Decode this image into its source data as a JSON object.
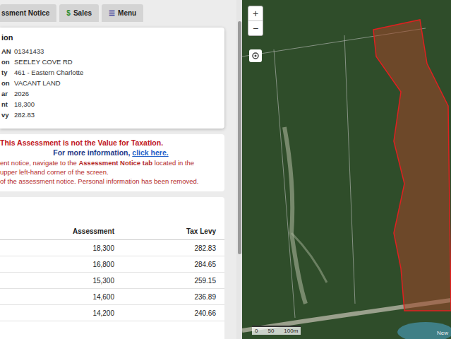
{
  "tabs": [
    {
      "label": "ssment Notice",
      "icon": "",
      "selected": false
    },
    {
      "label": "Sales",
      "icon": "$",
      "selected": false
    },
    {
      "label": "Menu",
      "icon": "☰",
      "selected": false
    }
  ],
  "info": {
    "title": "ion",
    "fields": [
      {
        "label": "AN",
        "value": "01341433"
      },
      {
        "label": "on",
        "value": "SEELEY COVE RD"
      },
      {
        "label": "ty",
        "value": "461 - Eastern Charlotte"
      },
      {
        "label": "on",
        "value": "VACANT LAND"
      },
      {
        "label": "ar",
        "value": "2026"
      },
      {
        "label": "nt",
        "value": "18,300"
      },
      {
        "label": "vy",
        "value": "282.83"
      }
    ]
  },
  "notice": {
    "warning": "This Assessment is not the Value for Taxation.",
    "more_prefix": "For more information, ",
    "link": "click here.",
    "lines": [
      [
        {
          "text": "ent notice, navigate to the ",
          "bold": false
        },
        {
          "text": "Assessment Notice tab",
          "bold": true
        },
        {
          "text": " located in the",
          "bold": false
        }
      ],
      [
        {
          "text": "upper left-hand corner of the screen.",
          "bold": false
        }
      ],
      [
        {
          "text": "of the assessment notice. Personal information has been removed.",
          "bold": false
        }
      ]
    ]
  },
  "history": {
    "columns": [
      "Assessment",
      "Tax Levy"
    ],
    "rows": [
      [
        "18,300",
        "282.83"
      ],
      [
        "16,800",
        "284.65"
      ],
      [
        "15,300",
        "259.15"
      ],
      [
        "14,600",
        "236.89"
      ],
      [
        "14,200",
        "240.66"
      ]
    ]
  },
  "map": {
    "zoom_in": "+",
    "zoom_out": "−",
    "scale": [
      "0",
      "50",
      "100m"
    ],
    "attribution": "New"
  }
}
